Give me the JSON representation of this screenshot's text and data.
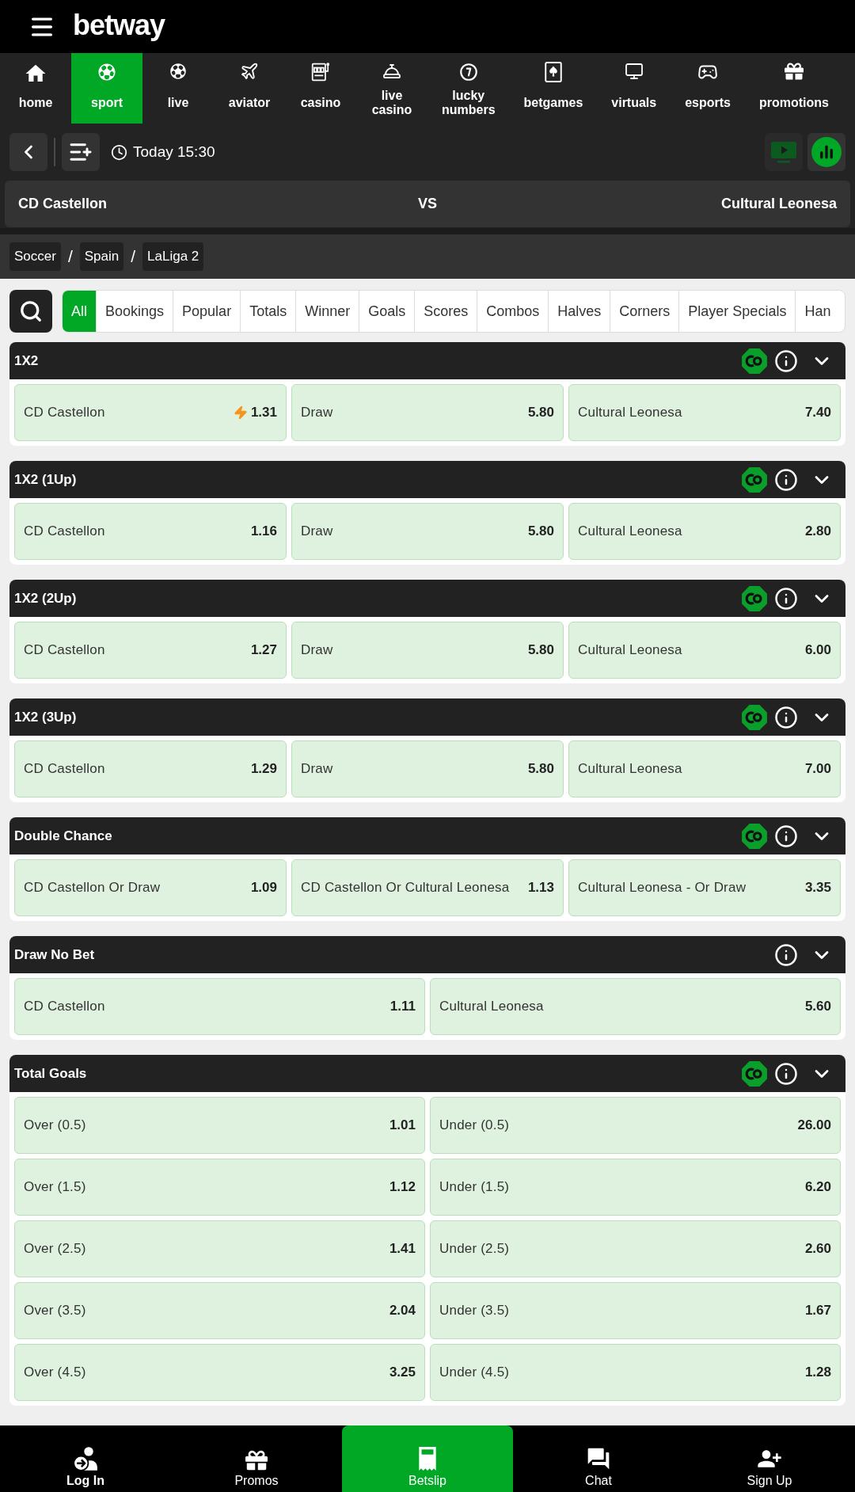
{
  "header": {
    "brand": "betway"
  },
  "nav": {
    "items": [
      {
        "label": "home",
        "selected": false
      },
      {
        "label": "sport",
        "selected": true
      },
      {
        "label": "live",
        "selected": false
      },
      {
        "label": "aviator",
        "selected": false
      },
      {
        "label": "casino",
        "selected": false
      },
      {
        "label": "live casino",
        "selected": false
      },
      {
        "label": "lucky numbers",
        "selected": false
      },
      {
        "label": "betgames",
        "selected": false
      },
      {
        "label": "virtuals",
        "selected": false
      },
      {
        "label": "esports",
        "selected": false
      },
      {
        "label": "promotions",
        "selected": false
      }
    ]
  },
  "event_bar": {
    "date_time": "Today 15:30",
    "buttons": [
      {
        "kind": "stream",
        "disabled": true
      },
      {
        "kind": "stats",
        "disabled": false
      }
    ]
  },
  "match": {
    "home": "CD Castellon",
    "vs": "VS",
    "away": "Cultural Leonesa"
  },
  "breadcrumb": {
    "items": [
      "Soccer",
      "Spain",
      "LaLiga 2"
    ],
    "separator": "/"
  },
  "filters": {
    "tabs": [
      {
        "label": "All",
        "selected": true
      },
      {
        "label": "Bookings",
        "selected": false
      },
      {
        "label": "Popular",
        "selected": false
      },
      {
        "label": "Totals",
        "selected": false
      },
      {
        "label": "Winner",
        "selected": false
      },
      {
        "label": "Goals",
        "selected": false
      },
      {
        "label": "Scores",
        "selected": false
      },
      {
        "label": "Combos",
        "selected": false
      },
      {
        "label": "Halves",
        "selected": false
      },
      {
        "label": "Corners",
        "selected": false
      },
      {
        "label": "Player Specials",
        "selected": false
      },
      {
        "label": "Han",
        "selected": false
      }
    ]
  },
  "markets": [
    {
      "title": "1X2",
      "cash_out": true,
      "expanded": true,
      "rows": [
        [
          {
            "label": "CD Castellon",
            "odds": "1.31",
            "boosted": true
          },
          {
            "label": "Draw",
            "odds": "5.80",
            "boosted": false
          },
          {
            "label": "Cultural Leonesa",
            "odds": "7.40",
            "boosted": false
          }
        ]
      ]
    },
    {
      "title": "1X2 (1Up)",
      "cash_out": true,
      "expanded": true,
      "rows": [
        [
          {
            "label": "CD Castellon",
            "odds": "1.16",
            "boosted": false
          },
          {
            "label": "Draw",
            "odds": "5.80",
            "boosted": false
          },
          {
            "label": "Cultural Leonesa",
            "odds": "2.80",
            "boosted": false
          }
        ]
      ]
    },
    {
      "title": "1X2 (2Up)",
      "cash_out": true,
      "expanded": true,
      "rows": [
        [
          {
            "label": "CD Castellon",
            "odds": "1.27",
            "boosted": false
          },
          {
            "label": "Draw",
            "odds": "5.80",
            "boosted": false
          },
          {
            "label": "Cultural Leonesa",
            "odds": "6.00",
            "boosted": false
          }
        ]
      ]
    },
    {
      "title": "1X2 (3Up)",
      "cash_out": true,
      "expanded": true,
      "rows": [
        [
          {
            "label": "CD Castellon",
            "odds": "1.29",
            "boosted": false
          },
          {
            "label": "Draw",
            "odds": "5.80",
            "boosted": false
          },
          {
            "label": "Cultural Leonesa",
            "odds": "7.00",
            "boosted": false
          }
        ]
      ]
    },
    {
      "title": "Double Chance",
      "cash_out": true,
      "expanded": true,
      "rows": [
        [
          {
            "label": "CD Castellon Or Draw",
            "odds": "1.09",
            "boosted": false
          },
          {
            "label": "CD Castellon Or Cultural Leonesa",
            "odds": "1.13",
            "boosted": false
          },
          {
            "label": "Cultural Leonesa - Or Draw",
            "odds": "3.35",
            "boosted": false
          }
        ]
      ]
    },
    {
      "title": "Draw No Bet",
      "cash_out": false,
      "expanded": true,
      "rows": [
        [
          {
            "label": "CD Castellon",
            "odds": "1.11",
            "boosted": false
          },
          {
            "label": "Cultural Leonesa",
            "odds": "5.60",
            "boosted": false
          }
        ]
      ]
    },
    {
      "title": "Total Goals",
      "cash_out": true,
      "expanded": true,
      "rows": [
        [
          {
            "label": "Over (0.5)",
            "odds": "1.01",
            "boosted": false
          },
          {
            "label": "Under (0.5)",
            "odds": "26.00",
            "boosted": false
          }
        ],
        [
          {
            "label": "Over (1.5)",
            "odds": "1.12",
            "boosted": false
          },
          {
            "label": "Under (1.5)",
            "odds": "6.20",
            "boosted": false
          }
        ],
        [
          {
            "label": "Over (2.5)",
            "odds": "1.41",
            "boosted": false
          },
          {
            "label": "Under (2.5)",
            "odds": "2.60",
            "boosted": false
          }
        ],
        [
          {
            "label": "Over (3.5)",
            "odds": "2.04",
            "boosted": false
          },
          {
            "label": "Under (3.5)",
            "odds": "1.67",
            "boosted": false
          }
        ],
        [
          {
            "label": "Over (4.5)",
            "odds": "3.25",
            "boosted": false
          },
          {
            "label": "Under (4.5)",
            "odds": "1.28",
            "boosted": false
          }
        ]
      ]
    }
  ],
  "bottom_nav": {
    "items": [
      {
        "label": "Log In",
        "selected": false,
        "bold": true
      },
      {
        "label": "Promos",
        "selected": false,
        "bold": false
      },
      {
        "label": "Betslip",
        "selected": true,
        "bold": false
      },
      {
        "label": "Chat",
        "selected": false,
        "bold": false
      },
      {
        "label": "Sign Up",
        "selected": false,
        "bold": false
      }
    ]
  }
}
